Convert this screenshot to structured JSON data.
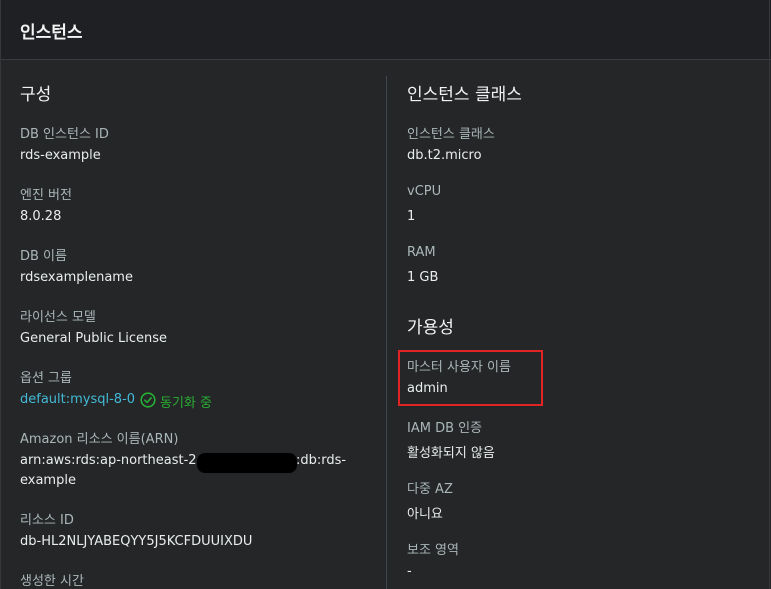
{
  "header": {
    "title": "인스턴스"
  },
  "config": {
    "title": "구성",
    "db_instance_id_label": "DB 인스턴스 ID",
    "db_instance_id_value": "rds-example",
    "engine_version_label": "엔진 버전",
    "engine_version_value": "8.0.28",
    "db_name_label": "DB 이름",
    "db_name_value": "rdsexamplename",
    "license_model_label": "라이선스 모델",
    "license_model_value": "General Public License",
    "option_group_label": "옵션 그룹",
    "option_group_link": "default:mysql-8-0",
    "option_group_status": "동기화 중",
    "arn_label": "Amazon 리소스 이름(ARN)",
    "arn_line1_prefix": "arn:aws:rds:ap-northeast-2:",
    "arn_line1_suffix": ":db:rds-",
    "arn_line2": "example",
    "resource_id_label": "리소스 ID",
    "resource_id_value": "db-HL2NLJYABEQYY5J5KCFDUUIXDU",
    "created_time_label": "생성한 시간"
  },
  "instance_class": {
    "title": "인스턴스 클래스",
    "class_label": "인스턴스 클래스",
    "class_value": "db.t2.micro",
    "vcpu_label": "vCPU",
    "vcpu_value": "1",
    "ram_label": "RAM",
    "ram_value": "1 GB"
  },
  "availability": {
    "title": "가용성",
    "master_user_label": "마스터 사용자 이름",
    "master_user_value": "admin",
    "iam_label": "IAM DB 인증",
    "iam_value": "활성화되지 않음",
    "multi_az_label": "다중 AZ",
    "multi_az_value": "아니요",
    "secondary_zone_label": "보조 영역",
    "secondary_zone_value": "-"
  },
  "colors": {
    "link": "#44b9d6",
    "status_success": "#29ad32",
    "highlight": "#e02424"
  }
}
